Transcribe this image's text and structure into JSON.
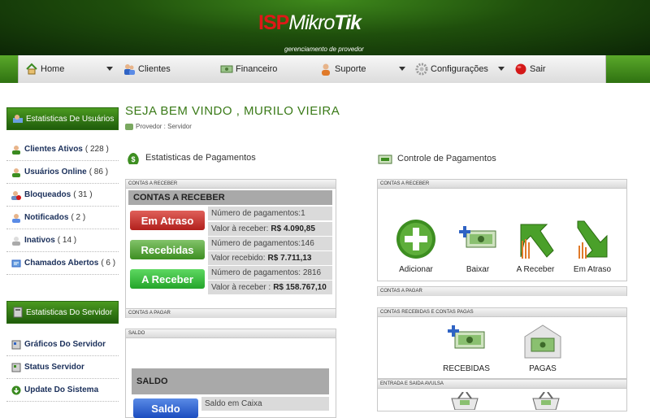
{
  "header": {
    "logo_isp": "ISP",
    "logo_mikro": "Mikro",
    "logo_tik": "Tik",
    "tagline": "gerenciamento de provedor"
  },
  "nav": [
    {
      "label": "Home",
      "icon": "home-icon",
      "caret": true
    },
    {
      "label": "Clientes",
      "icon": "users-icon",
      "caret": false
    },
    {
      "label": "Financeiro",
      "icon": "money-icon",
      "caret": false
    },
    {
      "label": "Suporte",
      "icon": "support-icon",
      "caret": true
    },
    {
      "label": "Configurações",
      "icon": "gear-icon",
      "caret": true
    },
    {
      "label": "Sair",
      "icon": "exit-icon",
      "caret": false
    }
  ],
  "sidebar": {
    "users_title": "Estatisticas De Usuários",
    "users_items": [
      {
        "label": "Clientes Ativos",
        "count": "( 228 )"
      },
      {
        "label": "Usuários Online",
        "count": "( 86 )"
      },
      {
        "label": "Bloqueados",
        "count": "( 31 )"
      },
      {
        "label": "Notificados",
        "count": "( 2 )"
      },
      {
        "label": "Inativos",
        "count": "( 14 )"
      },
      {
        "label": "Chamados Abertos",
        "count": "( 6 )"
      }
    ],
    "server_title": "Estatisticas Do Servidor",
    "server_items": [
      {
        "label": "Gráficos Do Servidor"
      },
      {
        "label": "Status Servidor"
      },
      {
        "label": "Update Do Sistema"
      }
    ]
  },
  "main": {
    "welcome": "SEJA BEM VINDO , MURILO VIEIRA",
    "breadcrumb": "Provedor : Servidor",
    "payments_title": "Estatisticas de Pagamentos",
    "control_title": "Controle de Pagamentos"
  },
  "payments": {
    "bar_receive": "CONTAS A RECEBER",
    "inner_title": "CONTAS A RECEBER",
    "rows": [
      {
        "button": "Em Atraso",
        "line1_label": "Número de pagamentos:",
        "line1_value": "1",
        "line2_label": "Valor à receber:",
        "line2_value": "R$ 4.090,85"
      },
      {
        "button": "Recebidas",
        "line1_label": "Número de pagamentos:",
        "line1_value": "146",
        "line2_label": "Valor recebido:",
        "line2_value": "R$ 7.711,13"
      },
      {
        "button": "A Receber",
        "line1_label": "Número de pagamentos:",
        "line1_value": "2816",
        "line2_label": "Valor à receber :",
        "line2_value": "R$ 158.767,10"
      }
    ],
    "bar_pay": "CONTAS A PAGAR",
    "bar_saldo": "SALDO",
    "saldo_inner_title": "SALDO",
    "saldo_button": "Saldo",
    "saldo_cell": "Saldo em Caixa"
  },
  "control": {
    "bar_receive": "CONTAS A RECEBER",
    "actions": [
      {
        "label": "Adicionar",
        "icon": "add-icon"
      },
      {
        "label": "Baixar",
        "icon": "money-add-icon"
      },
      {
        "label": "A Receber",
        "icon": "arrow-up-icon"
      },
      {
        "label": "Em Atraso",
        "icon": "arrow-down-icon"
      }
    ],
    "bar_pay": "CONTAS A PAGAR",
    "bar_received_paid": "CONTAS RECEBIDAS E CONTAS PAGAS",
    "received_paid": [
      {
        "label": "RECEBIDAS",
        "icon": "money-add-icon"
      },
      {
        "label": "PAGAS",
        "icon": "envelope-money-icon"
      }
    ],
    "bar_entries": "ENTRADA E SAIDA AVULSA"
  },
  "colors": {
    "brand_green": "#3a7a18",
    "logo_red": "#e01818",
    "late_red": "#b1201c",
    "received_green": "#3d8e21"
  }
}
